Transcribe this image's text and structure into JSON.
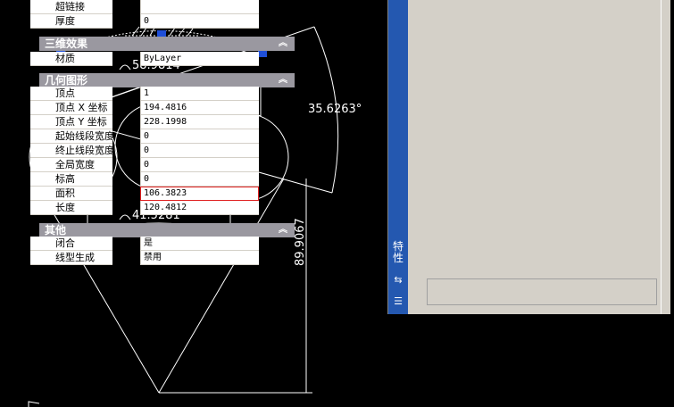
{
  "drawing": {
    "dimensions": {
      "arc_top": "58.9814",
      "arc_bottom": "41.5281",
      "angle": "35.6263°",
      "height": "89.9067"
    }
  },
  "palette": {
    "title": "特性",
    "top_rows": [
      {
        "label": "超链接",
        "value": ""
      },
      {
        "label": "厚度",
        "value": "0"
      }
    ],
    "sections": [
      {
        "title": "三维效果",
        "rows": [
          {
            "label": "材质",
            "value": "ByLayer"
          }
        ]
      },
      {
        "title": "几何图形",
        "rows": [
          {
            "label": "顶点",
            "value": "1"
          },
          {
            "label": "顶点 X 坐标",
            "value": "194.4816"
          },
          {
            "label": "顶点 Y 坐标",
            "value": "228.1998"
          },
          {
            "label": "起始线段宽度",
            "value": "0"
          },
          {
            "label": "终止线段宽度",
            "value": "0"
          },
          {
            "label": "全局宽度",
            "value": "0"
          },
          {
            "label": "标高",
            "value": "0"
          },
          {
            "label": "面积",
            "value": "106.3823"
          },
          {
            "label": "长度",
            "value": "120.4812"
          }
        ]
      },
      {
        "title": "其他",
        "rows": [
          {
            "label": "闭合",
            "value": "是"
          },
          {
            "label": "线型生成",
            "value": "禁用"
          }
        ]
      }
    ]
  },
  "colors": {
    "canvas": "#000000",
    "grip": "#1f4fd8",
    "selection_highlight": "#e02020"
  }
}
